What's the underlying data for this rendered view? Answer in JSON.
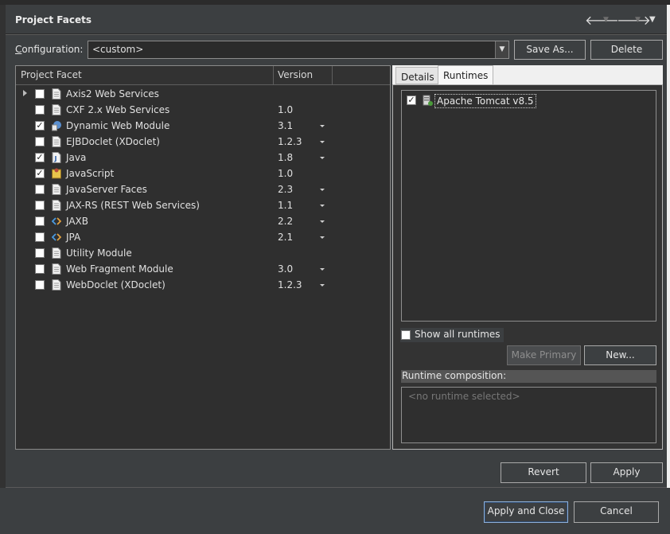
{
  "window": {
    "title": "Project Facets"
  },
  "configuration": {
    "label": "Configuration:",
    "value": "<custom>",
    "save_as": "Save As...",
    "delete": "Delete"
  },
  "facets": {
    "columns": [
      "Project Facet",
      "Version"
    ],
    "rows": [
      {
        "name": "Axis2 Web Services",
        "version": "",
        "checked": false,
        "expandable": true,
        "icon": "page-icon",
        "dropdown": false
      },
      {
        "name": "CXF 2.x Web Services",
        "version": "1.0",
        "checked": false,
        "expandable": false,
        "icon": "page-icon",
        "dropdown": false
      },
      {
        "name": "Dynamic Web Module",
        "version": "3.1",
        "checked": true,
        "expandable": false,
        "icon": "web-module-icon",
        "dropdown": true
      },
      {
        "name": "EJBDoclet (XDoclet)",
        "version": "1.2.3",
        "checked": false,
        "expandable": false,
        "icon": "page-icon",
        "dropdown": true
      },
      {
        "name": "Java",
        "version": "1.8",
        "checked": true,
        "expandable": false,
        "icon": "java-icon",
        "dropdown": true
      },
      {
        "name": "JavaScript",
        "version": "1.0",
        "checked": true,
        "expandable": false,
        "icon": "javascript-icon",
        "dropdown": false
      },
      {
        "name": "JavaServer Faces",
        "version": "2.3",
        "checked": false,
        "expandable": false,
        "icon": "page-icon",
        "dropdown": true
      },
      {
        "name": "JAX-RS (REST Web Services)",
        "version": "1.1",
        "checked": false,
        "expandable": false,
        "icon": "page-icon",
        "dropdown": true
      },
      {
        "name": "JAXB",
        "version": "2.2",
        "checked": false,
        "expandable": false,
        "icon": "xml-icon",
        "dropdown": true
      },
      {
        "name": "JPA",
        "version": "2.1",
        "checked": false,
        "expandable": false,
        "icon": "xml-icon",
        "dropdown": true
      },
      {
        "name": "Utility Module",
        "version": "",
        "checked": false,
        "expandable": false,
        "icon": "page-icon",
        "dropdown": false
      },
      {
        "name": "Web Fragment Module",
        "version": "3.0",
        "checked": false,
        "expandable": false,
        "icon": "page-icon",
        "dropdown": true
      },
      {
        "name": "WebDoclet (XDoclet)",
        "version": "1.2.3",
        "checked": false,
        "expandable": false,
        "icon": "page-icon",
        "dropdown": true
      }
    ]
  },
  "tabs": {
    "details": "Details",
    "runtimes": "Runtimes",
    "active": "runtimes"
  },
  "runtimes": {
    "items": [
      {
        "name": "Apache Tomcat v8.5",
        "checked": true
      }
    ],
    "show_all": "Show all runtimes",
    "make_primary": "Make Primary",
    "new": "New...",
    "composition_label": "Runtime composition:",
    "composition_empty": "<no runtime selected>"
  },
  "actions": {
    "revert": "Revert",
    "apply": "Apply",
    "apply_close": "Apply and Close",
    "cancel": "Cancel"
  }
}
